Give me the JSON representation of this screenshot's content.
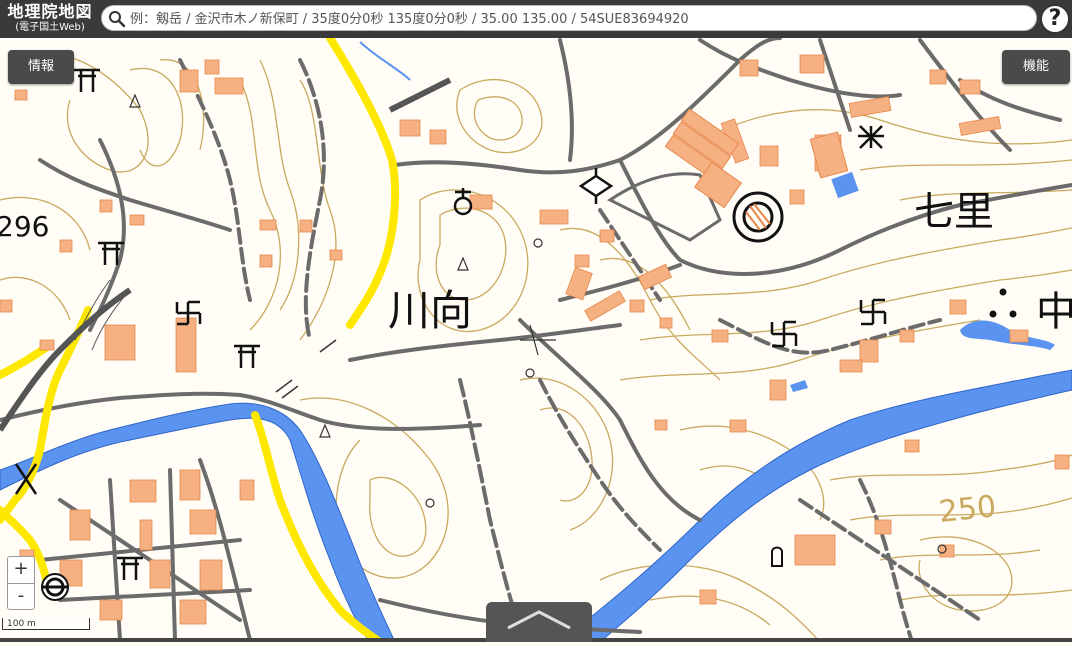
{
  "app": {
    "logo_main": "地理院地図",
    "logo_sub": "(電子国土Web)"
  },
  "search": {
    "placeholder": "例：剱岳 / 金沢市木ノ新保町 / 35度0分0秒 135度0分0秒 / 35.00 135.00 / 54SUE83694920"
  },
  "buttons": {
    "info": "情報",
    "functions": "機能",
    "help": "?",
    "zoom_in": "+",
    "zoom_out": "-"
  },
  "scale": {
    "label": "100 m"
  },
  "map": {
    "place_labels": {
      "kawamukai": "川向",
      "shichiri": "七里",
      "naka_partial": "中"
    },
    "elevation_labels": {
      "e296": "296",
      "e250": "250"
    }
  },
  "colors": {
    "toolbar": "#3a3a3a",
    "road_major": "#ffe600",
    "river": "#4d8ff5",
    "building": "#f5ad7a",
    "contour": "#c7a85c",
    "road": "#666666"
  },
  "icons": [
    "shrine-icon",
    "temple-icon",
    "school-icon",
    "city-hall-icon",
    "police-box-icon",
    "post-office-icon",
    "monument-icon",
    "search-icon",
    "locate-icon"
  ]
}
